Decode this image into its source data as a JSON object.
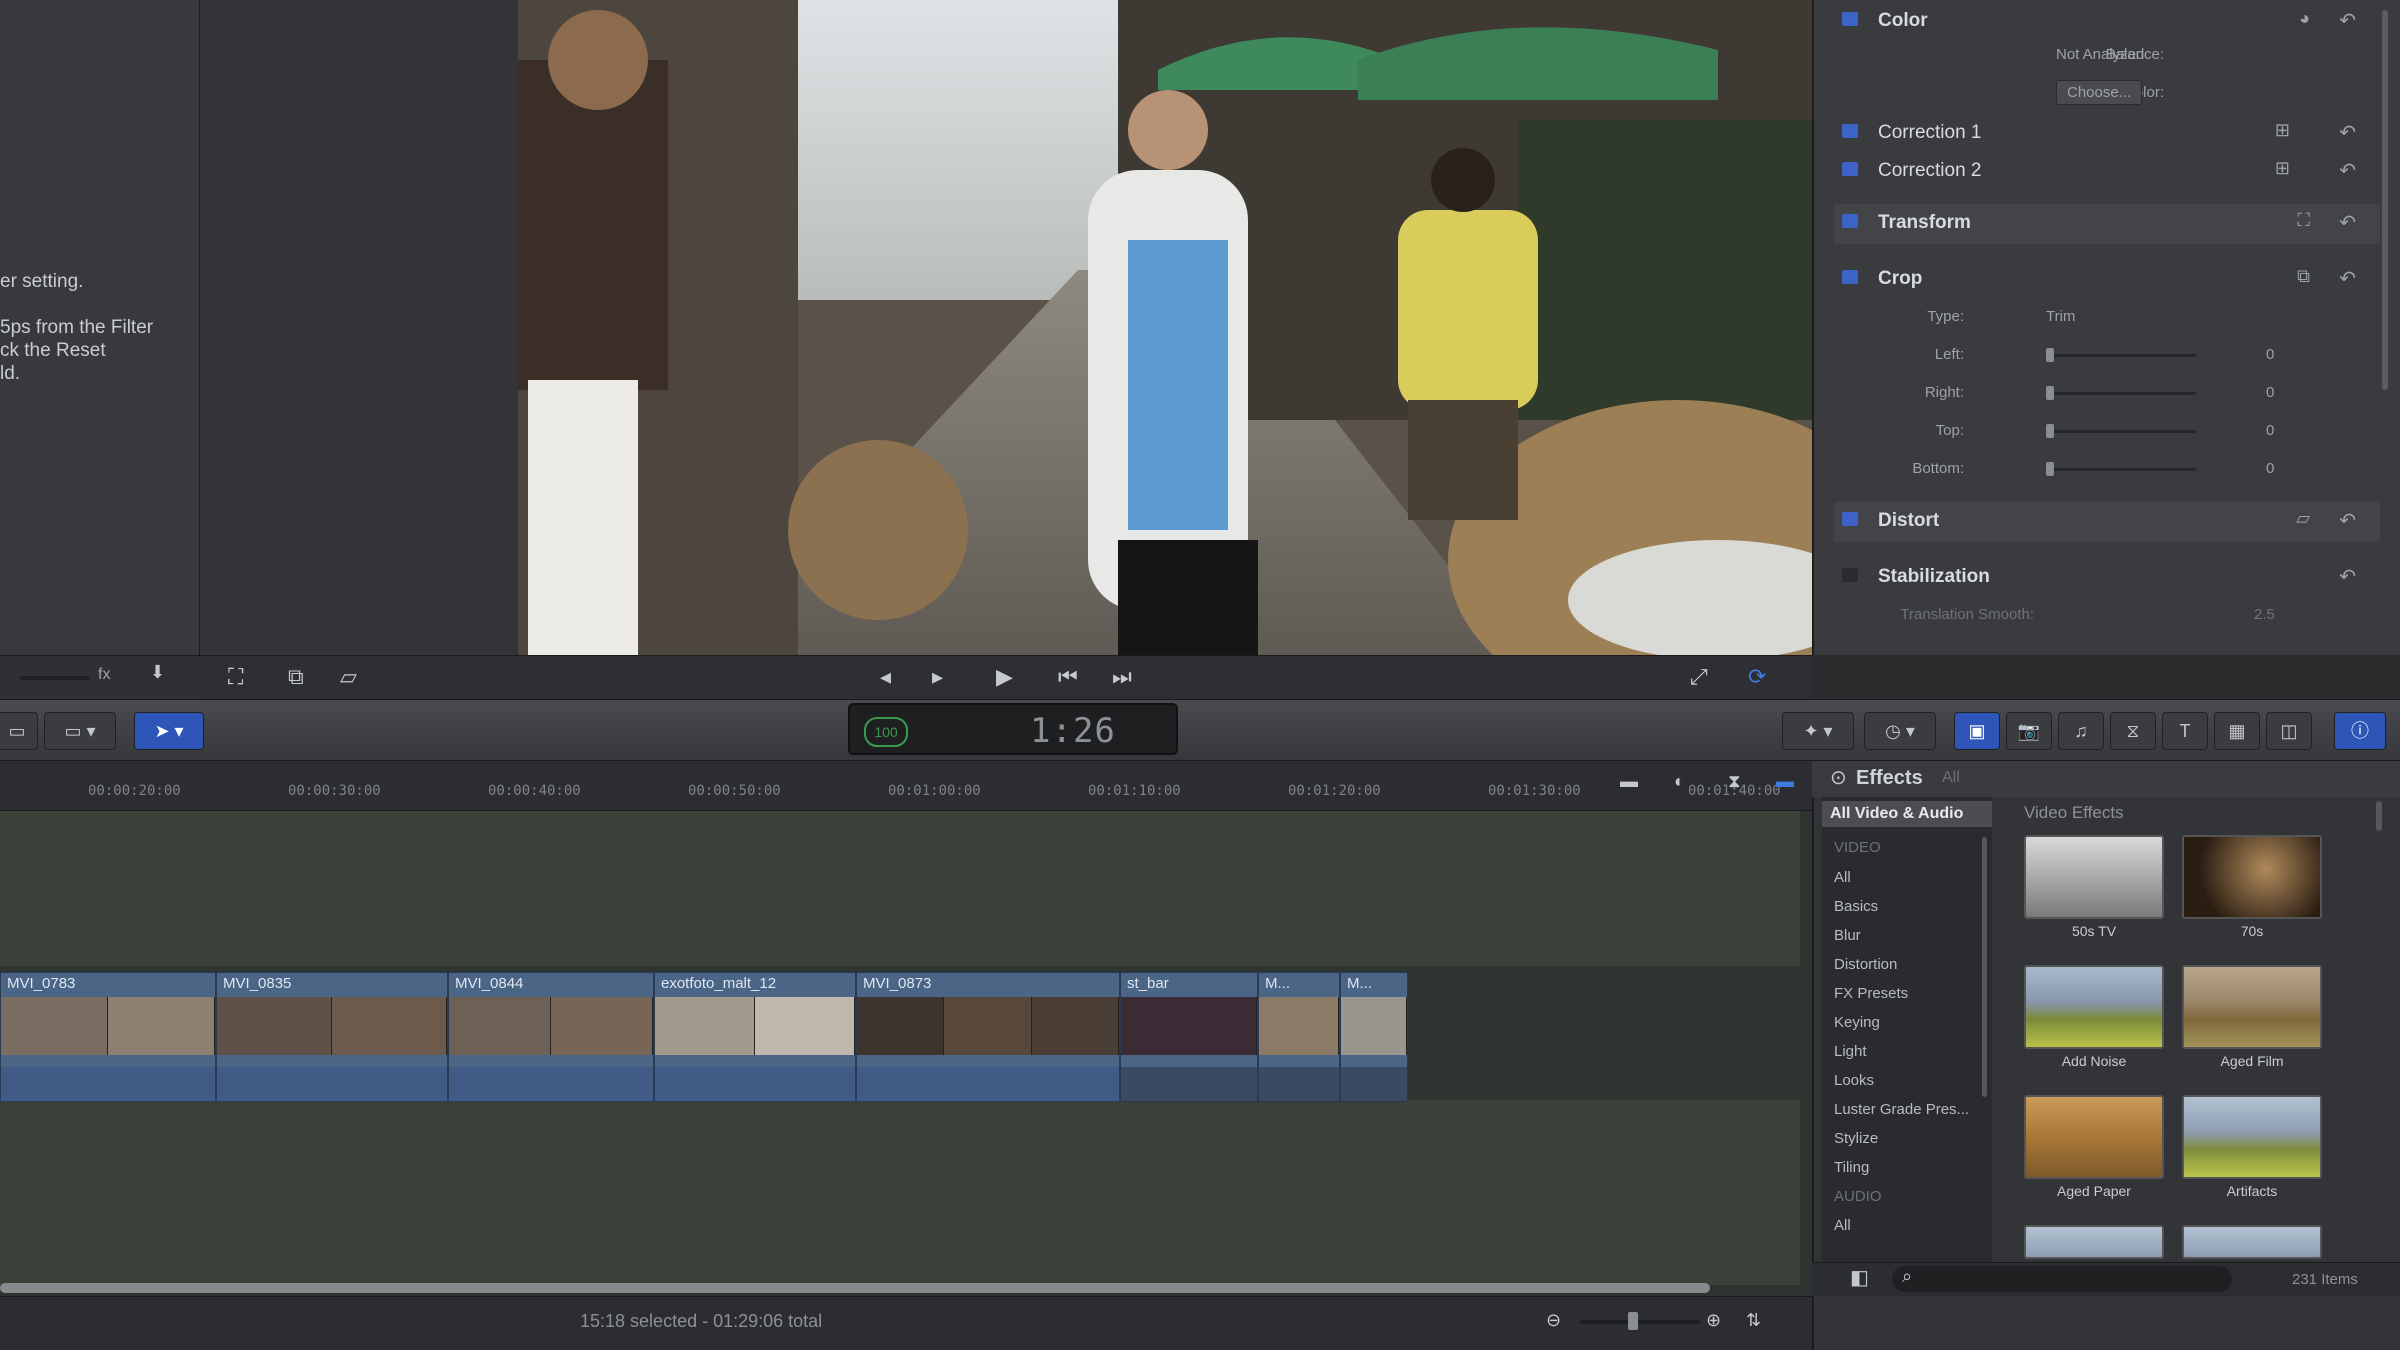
{
  "left_panel": {
    "help_lines": [
      "er setting.",
      "",
      "5ps from the Filter",
      "ck the Reset",
      "ld."
    ],
    "footer_value": "fx"
  },
  "viewer": {
    "controls": {
      "play": "▶"
    }
  },
  "inspector": {
    "sections": [
      {
        "title": "Color"
      },
      {
        "title": "Correction 1"
      },
      {
        "title": "Correction 2"
      },
      {
        "title": "Transform"
      },
      {
        "title": "Crop"
      },
      {
        "title": "Distort"
      },
      {
        "title": "Stabilization"
      }
    ],
    "color_balance_label": "Balance:",
    "color_balance_value": "Not Analyzed",
    "match_color_label": "Match Color:",
    "match_color_button": "Choose...",
    "crop_type_label": "Type:",
    "crop_type_value": "Trim",
    "crop_params": [
      {
        "label": "Left:",
        "value": "0"
      },
      {
        "label": "Right:",
        "value": "0"
      },
      {
        "label": "Top:",
        "value": "0"
      },
      {
        "label": "Bottom:",
        "value": "0"
      }
    ],
    "stabilization_row_label": "Translation Smooth:",
    "stabilization_row_value": "2.5"
  },
  "toolbar": {
    "timecode": "1:26",
    "timecode_badge": "100"
  },
  "timeline": {
    "ruler_ticks": [
      "00:00:20:00",
      "00:00:30:00",
      "00:00:40:00",
      "00:00:50:00",
      "00:01:00:00",
      "00:01:10:00",
      "00:01:20:00",
      "00:01:30:00",
      "00:01:40:00"
    ],
    "clips": [
      {
        "name": "MVI_0783"
      },
      {
        "name": "MVI_0835"
      },
      {
        "name": "MVI_0844"
      },
      {
        "name": "exotfoto_malt_12"
      },
      {
        "name": "MVI_0873"
      },
      {
        "name": "st_bar"
      },
      {
        "name": "M..."
      },
      {
        "name": "M..."
      }
    ],
    "status": "15:18 selected - 01:29:06 total"
  },
  "effects": {
    "header": "Effects",
    "header_sub": "All",
    "list": {
      "top": "All Video & Audio",
      "video_group": "VIDEO",
      "video_items": [
        "All",
        "Basics",
        "Blur",
        "Distortion",
        "FX Presets",
        "Keying",
        "Light",
        "Looks",
        "Luster Grade Pres...",
        "Stylize",
        "Tiling"
      ],
      "audio_group": "AUDIO",
      "audio_items": [
        "All"
      ]
    },
    "grid_title": "Video Effects",
    "grid": [
      {
        "label": "50s TV"
      },
      {
        "label": "70s"
      },
      {
        "label": "Add Noise"
      },
      {
        "label": "Aged Film"
      },
      {
        "label": "Aged Paper"
      },
      {
        "label": "Artifacts"
      }
    ],
    "count": "231 Items"
  },
  "colors": {
    "accent_blue": "#2d56b8",
    "clip_blue": "#4a6586",
    "timecode_green": "#3c9a4b"
  }
}
